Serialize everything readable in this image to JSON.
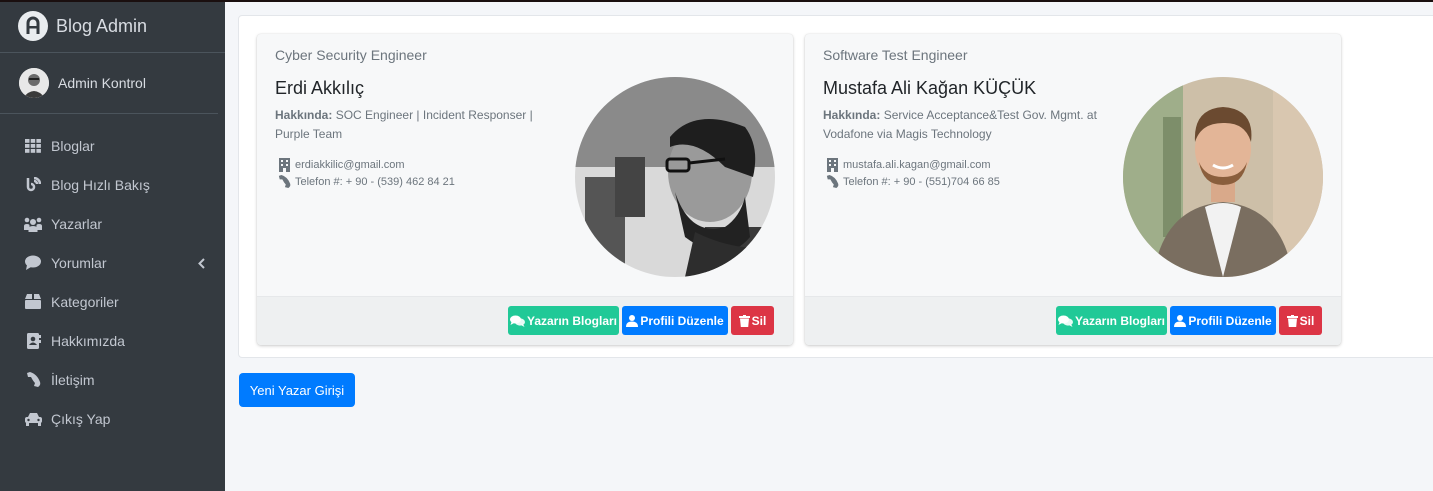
{
  "brand": {
    "title": "Blog Admin"
  },
  "user": {
    "name": "Admin Kontrol"
  },
  "nav": [
    {
      "label": "Bloglar",
      "icon": "grid-icon"
    },
    {
      "label": "Blog Hızlı Bakış",
      "icon": "blog-icon"
    },
    {
      "label": "Yazarlar",
      "icon": "users-icon"
    },
    {
      "label": "Yorumlar",
      "icon": "comment-icon"
    },
    {
      "label": "Kategoriler",
      "icon": "box-icon"
    },
    {
      "label": "Hakkımızda",
      "icon": "address-book-icon"
    },
    {
      "label": "İletişim",
      "icon": "phone-icon"
    },
    {
      "label": "Çıkış Yap",
      "icon": "car-icon"
    }
  ],
  "authors": [
    {
      "title": "Cyber Security Engineer",
      "name": "Erdi Akkılıç",
      "about_label": "Hakkında:",
      "about": "SOC Engineer | Incident Responser | Purple Team",
      "email": "erdiakkilic@gmail.com",
      "phone": "Telefon #: + 90 - (539) 462 84 21",
      "buttons": {
        "blogs": "Yazarın Blogları",
        "edit": "Profili Düzenle",
        "delete": "Sil"
      }
    },
    {
      "title": "Software Test Engineer",
      "name": "Mustafa Ali Kağan KÜÇÜK",
      "about_label": "Hakkında:",
      "about": "Service Acceptance&Test Gov. Mgmt. at Vodafone via Magis Technology",
      "email": "mustafa.ali.kagan@gmail.com",
      "phone": "Telefon #: + 90 - (551)704 66 85",
      "buttons": {
        "blogs": "Yazarın Blogları",
        "edit": "Profili Düzenle",
        "delete": "Sil"
      }
    }
  ],
  "new_author_button": "Yeni Yazar Girişi",
  "colors": {
    "sidebar": "#343a40",
    "green": "#20c997",
    "blue": "#007bff",
    "red": "#dc3545"
  }
}
